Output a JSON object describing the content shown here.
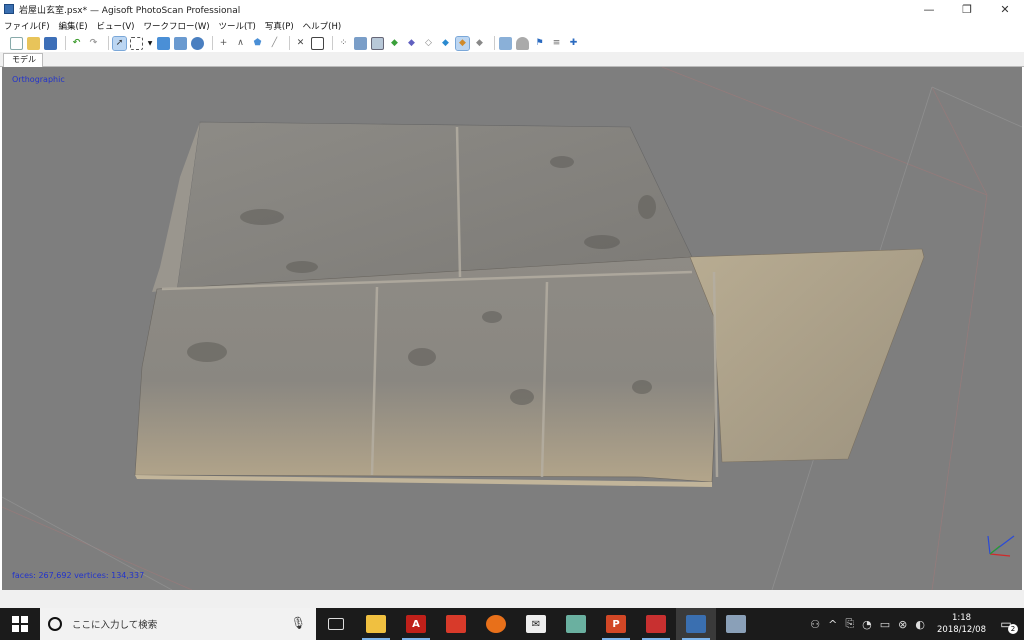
{
  "window": {
    "title": "岩屋山玄室.psx* — Agisoft PhotoScan Professional",
    "min": "—",
    "restore": "❐",
    "close": "✕"
  },
  "menu": [
    "ファイル(F)",
    "編集(E)",
    "ビュー(V)",
    "ワークフロー(W)",
    "ツール(T)",
    "写真(P)",
    "ヘルプ(H)"
  ],
  "toolbar_icons": [
    "new-file",
    "open-folder",
    "save",
    "undo",
    "redo",
    "select-arrow",
    "rect-select",
    "dropdown",
    "navigate",
    "rotate",
    "resize",
    "move",
    "polyline",
    "polygon",
    "ruler",
    "delete",
    "crop",
    "points",
    "dense",
    "grid",
    "solid",
    "shaded",
    "textured",
    "tiled",
    "camera",
    "frame",
    "flag",
    "reset-view",
    "axis"
  ],
  "tab": {
    "label": "モデル"
  },
  "viewport": {
    "view_mode": "Orthographic",
    "stats": "faces: 267,692 vertices: 134,337",
    "background": "#7e7e7e"
  },
  "taskbar": {
    "search_placeholder": "ここに入力して検索",
    "apps": [
      "task-view",
      "file-explorer",
      "acrobat",
      "presentation",
      "firefox",
      "mail",
      "app-green",
      "powerpoint",
      "picture-app",
      "photoscan",
      "network-app"
    ],
    "time": "1:18",
    "date": "2018/12/08",
    "notifications": "2"
  }
}
